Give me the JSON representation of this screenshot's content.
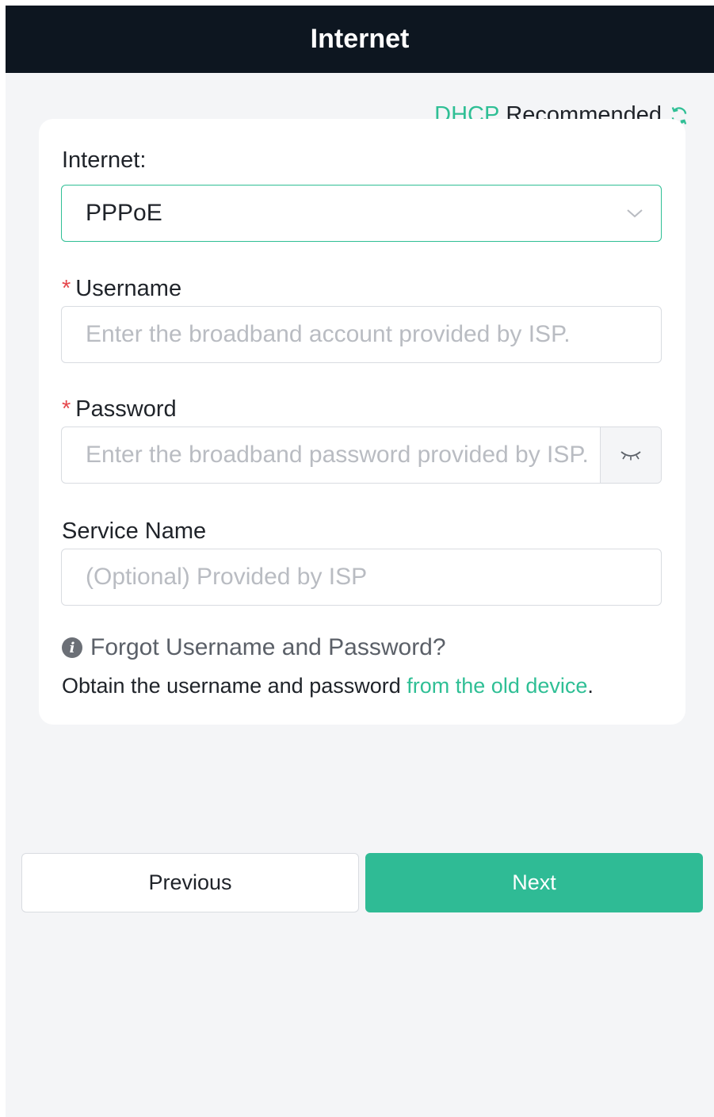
{
  "header": {
    "title": "Internet"
  },
  "recommend": {
    "protocol": "DHCP",
    "text": "Recommended",
    "icon": "refresh-icon"
  },
  "form": {
    "internet_label": "Internet:",
    "internet_value": "PPPoE",
    "username_label": "Username",
    "username_placeholder": "Enter the broadband account provided by ISP.",
    "password_label": "Password",
    "password_placeholder": "Enter the broadband password provided by ISP.",
    "service_label": "Service Name",
    "service_placeholder": "(Optional) Provided by ISP",
    "required_mark": "*"
  },
  "help": {
    "forgot": "Forgot Username and Password?",
    "obtain_prefix": "Obtain the username and password ",
    "obtain_link": "from the old device",
    "obtain_suffix": "."
  },
  "buttons": {
    "previous": "Previous",
    "next": "Next"
  },
  "colors": {
    "accent": "#2fbb95",
    "header_bg": "#0d1620",
    "required": "#e5484d"
  }
}
